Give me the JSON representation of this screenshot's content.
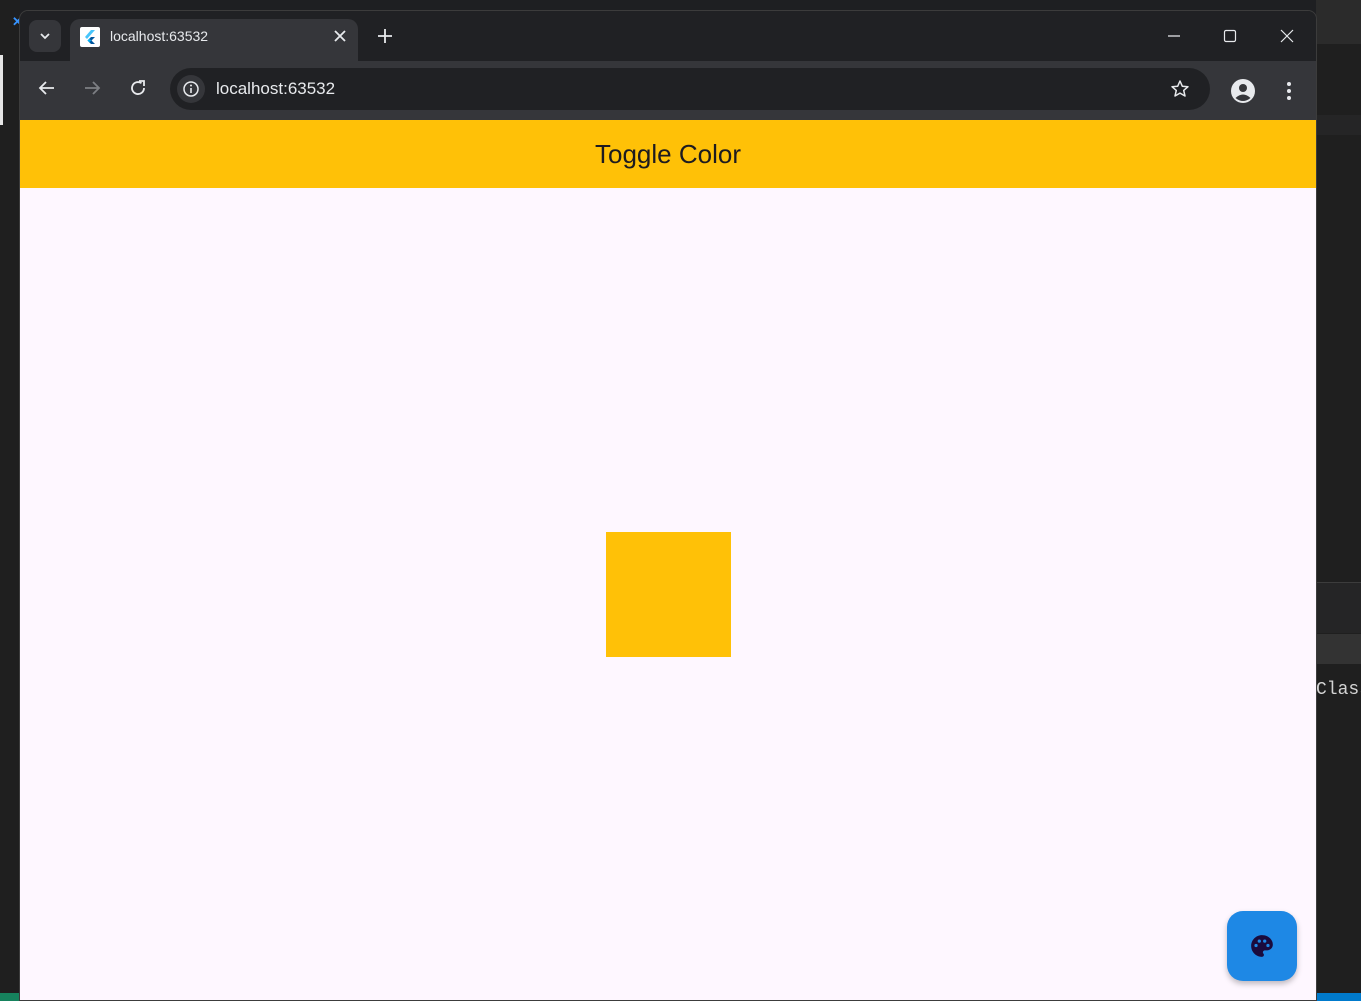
{
  "browser": {
    "tab_title": "localhost:63532",
    "url": "localhost:63532"
  },
  "app": {
    "title": "Toggle Color",
    "accent_color": "#ffc107",
    "box_color": "#ffc107",
    "background_color": "#fef7ff",
    "fab_color": "#1e88e5",
    "fab_icon": "palette-icon"
  },
  "background": {
    "editor_text": "Class"
  }
}
